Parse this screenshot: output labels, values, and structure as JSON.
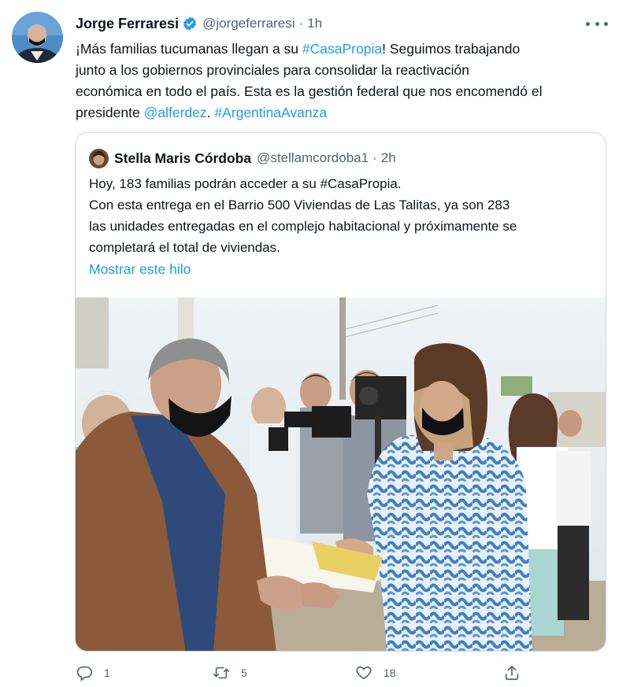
{
  "tweet": {
    "author_name": "Jorge Ferraresi",
    "author_handle": "@jorgeferraresi",
    "time": "1h",
    "separator": "·",
    "lines": [
      [
        {
          "t": "¡Más familias tucumanas llegan a su ",
          "link": false
        },
        {
          "t": "#CasaPropia",
          "link": true
        },
        {
          "t": "! Seguimos trabajando",
          "link": false
        }
      ],
      [
        {
          "t": "junto a los gobiernos provinciales para consolidar la reactivación",
          "link": false
        }
      ],
      [
        {
          "t": "económica en todo el país. Esta es la gestión federal que nos encomendó el",
          "link": false
        }
      ],
      [
        {
          "t": "presidente ",
          "link": false
        },
        {
          "t": "@alferdez",
          "link": true
        },
        {
          "t": ". ",
          "link": false
        },
        {
          "t": "#ArgentinaAvanza",
          "link": true
        }
      ]
    ]
  },
  "quote": {
    "author_name": "Stella Maris Córdoba",
    "author_handle": "@stellamcordoba1",
    "time": "2h",
    "separator": "·",
    "lines": [
      "Hoy, 183 familias podrán acceder a su #CasaPropia.",
      "Con esta entrega en el Barrio 500 Viviendas de Las Talitas, ya son 283",
      "las unidades entregadas en el complejo habitacional y próximamente se",
      "completará el total de viviendas."
    ],
    "show_thread": "Mostrar este hilo",
    "photo_icon": "photo-image"
  },
  "actions": {
    "reply": {
      "icon": "reply-icon",
      "count": "1"
    },
    "retweet": {
      "icon": "retweet-icon",
      "count": "5"
    },
    "like": {
      "icon": "heart-icon",
      "count": "18"
    },
    "share": {
      "icon": "share-icon",
      "count": ""
    }
  },
  "colors": {
    "link": "#1d9bf0",
    "muted": "#536471",
    "border": "#cfd9de",
    "verified": "#1d9bf0"
  }
}
